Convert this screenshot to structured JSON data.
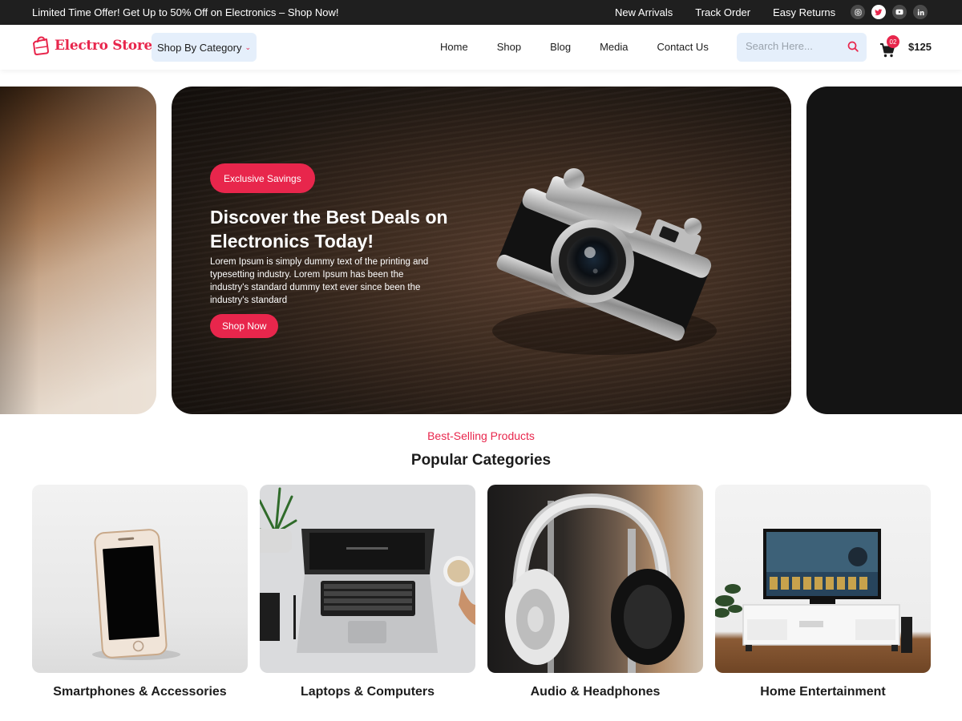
{
  "topbar": {
    "offer": "Limited Time Offer! Get Up to 50% Off on Electronics – Shop Now!",
    "links": [
      "New Arrivals",
      "Track Order",
      "Easy Returns"
    ],
    "social_icons": [
      "instagram-icon",
      "twitter-icon",
      "youtube-icon",
      "linkedin-icon"
    ]
  },
  "header": {
    "logo": "Electro Store",
    "category_button": "Shop By Category",
    "nav": [
      "Home",
      "Shop",
      "Blog",
      "Media",
      "Contact Us"
    ],
    "search_placeholder": "Search Here...",
    "cart_count": "02",
    "cart_total": "$125"
  },
  "hero": {
    "badge": "Exclusive Savings",
    "title": "Discover the Best Deals on Electronics Today!",
    "description": "Lorem Ipsum is simply dummy text of the printing and typesetting industry. Lorem Ipsum has been the industry's standard dummy text ever since been the industry's standard",
    "cta": "Shop Now"
  },
  "categories": {
    "eyebrow": "Best-Selling Products",
    "title": "Popular Categories",
    "items": [
      {
        "label": "Smartphones & Accessories"
      },
      {
        "label": "Laptops & Computers"
      },
      {
        "label": "Audio & Headphones"
      },
      {
        "label": "Home Entertainment"
      }
    ]
  },
  "colors": {
    "accent": "#e8264c",
    "topbar_bg": "#1f1f1f",
    "field_bg": "#e5effb"
  }
}
